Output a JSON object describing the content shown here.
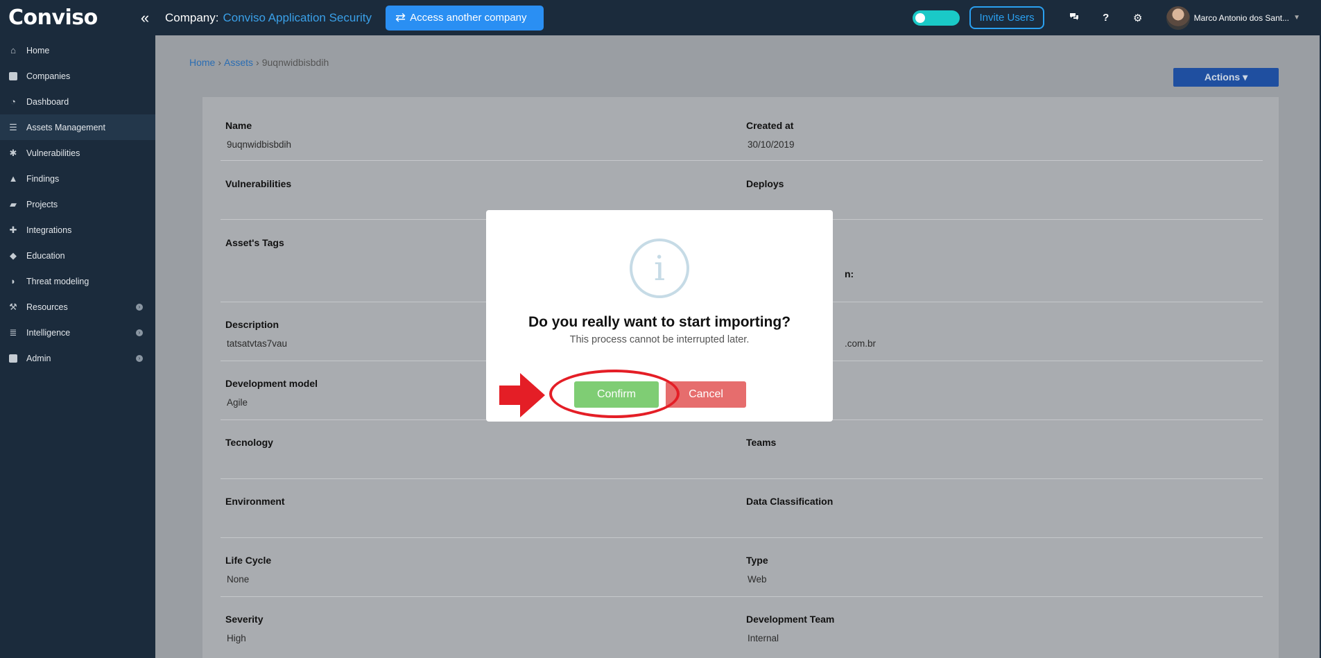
{
  "topbar": {
    "logo": "Conviso",
    "collapse_icon": "double-chevron-left-icon",
    "company_label": "Company:",
    "company_name": "Conviso Application Security",
    "switch_label": "Access another company",
    "invite_label": "Invite Users",
    "user_name": "Marco Antonio dos Sant..."
  },
  "sidebar": {
    "items": [
      {
        "label": "Home",
        "icon": "home-icon"
      },
      {
        "label": "Companies",
        "icon": "building-icon"
      },
      {
        "label": "Dashboard",
        "icon": "dashboard-icon"
      },
      {
        "label": "Assets Management",
        "icon": "server-icon"
      },
      {
        "label": "Vulnerabilities",
        "icon": "bug-icon"
      },
      {
        "label": "Findings",
        "icon": "flask-icon"
      },
      {
        "label": "Projects",
        "icon": "folder-icon"
      },
      {
        "label": "Integrations",
        "icon": "puzzle-icon"
      },
      {
        "label": "Education",
        "icon": "graduation-cap-icon"
      },
      {
        "label": "Threat modeling",
        "icon": "shield-icon"
      },
      {
        "label": "Resources",
        "icon": "wrench-icon"
      },
      {
        "label": "Intelligence",
        "icon": "database-icon"
      },
      {
        "label": "Admin",
        "icon": "briefcase-icon"
      }
    ]
  },
  "breadcrumb": {
    "home": "Home",
    "assets": "Assets",
    "current": "9uqnwidbisbdih"
  },
  "actions_label": "Actions ▾",
  "asset": {
    "name_label": "Name",
    "name_value": "9uqnwidbisbdih",
    "created_label": "Created at",
    "created_value": "30/10/2019",
    "vulns_label": "Vulnerabilities",
    "deploys_label": "Deploys",
    "tags_label": "Asset's Tags",
    "partial_label": "n:",
    "desc_label": "Description",
    "desc_value": "tatsatvtas7vau",
    "partial_value": ".com.br",
    "devmodel_label": "Development model",
    "devmodel_value": "Agile",
    "tech_label": "Tecnology",
    "teams_label": "Teams",
    "env_label": "Environment",
    "dataclass_label": "Data Classification",
    "lifecycle_label": "Life Cycle",
    "lifecycle_value": "None",
    "type_label": "Type",
    "type_value": "Web",
    "severity_label": "Severity",
    "severity_value": "High",
    "devteam_label": "Development Team",
    "devteam_value": "Internal"
  },
  "modal": {
    "icon": "info-icon",
    "title": "Do you really want to start importing?",
    "text": "This process cannot be interrupted later.",
    "confirm": "Confirm",
    "cancel": "Cancel"
  },
  "colors": {
    "nav_bg": "#1b2b3c",
    "accent": "#2a8ff3",
    "confirm": "#7fcd74",
    "cancel": "#e66d6d",
    "highlight": "#e41e26"
  }
}
